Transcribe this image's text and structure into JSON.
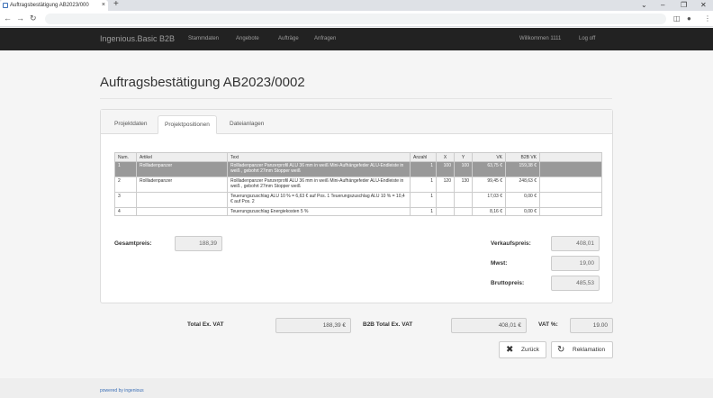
{
  "browser": {
    "tab_title": "Auftragsbestätigung AB2023/000",
    "close_glyph": "×",
    "new_tab_glyph": "+"
  },
  "navbar": {
    "brand": "Ingenious.Basic B2B",
    "links": [
      "Stammdaten",
      "Angebote",
      "Aufträge",
      "Anfragen"
    ],
    "welcome": "Willkommen 1111",
    "logout": "Log off"
  },
  "page": {
    "title": "Auftragsbestätigung AB2023/0002"
  },
  "tabs": [
    "Projektdaten",
    "Projektpositionen",
    "Dateianlagen"
  ],
  "table": {
    "headers": [
      "Num.",
      "Artikel",
      "Text",
      "Anzahl",
      "X",
      "Y",
      "VK",
      "B2B VK",
      ""
    ],
    "rows": [
      [
        "1",
        "Rollladenpanzer",
        "Rollladenpanzer Panzerprofil ALU 36 mm in weiß Mini-Aufhängefeder ALU-Endleiste in weiß , gebohrt 27mm Stopper weiß",
        "1",
        "100",
        "100",
        "63,75 €",
        "159,38 €",
        ""
      ],
      [
        "2",
        "Rollladenpanzer",
        "Rollladenpanzer Panzerprofil ALU 36 mm in weiß Mini-Aufhängefeder ALU-Endleiste in weiß , gebohrt 27mm Stopper weiß",
        "1",
        "120",
        "130",
        "99,45 €",
        "248,63 €",
        ""
      ],
      [
        "3",
        "",
        "Teuerungszuschlag ALU 10 % = 6,63 € auf Pos. 1 Teuerungszuschlag ALU 10 % = 10,4 € auf Pos. 2",
        "1",
        "",
        "",
        "17,03 €",
        "0,00 €",
        ""
      ],
      [
        "4",
        "",
        "Teuerungszuschlag Energiekosten 5 %",
        "1",
        "",
        "",
        "8,16 €",
        "0,00 €",
        ""
      ]
    ]
  },
  "summary": {
    "gesamtpreis_label": "Gesamtpreis:",
    "gesamtpreis": "188,39",
    "verkaufspreis_label": "Verkaufspreis:",
    "verkaufspreis": "408,01",
    "mwst_label": "Mwst:",
    "mwst": "19,00",
    "brutto_label": "Bruttopreis:",
    "brutto": "485,53"
  },
  "totals": {
    "total_ex_vat_label": "Total Ex. VAT",
    "total_ex_vat": "188,39 €",
    "b2b_total_label": "B2B Total Ex. VAT",
    "b2b_total": "408,01 €",
    "vat_label": "VAT %:",
    "vat": "19.00"
  },
  "buttons": {
    "back": "Zurück",
    "complaint": "Reklamation"
  },
  "footer": {
    "text": "powered by ingenious"
  }
}
